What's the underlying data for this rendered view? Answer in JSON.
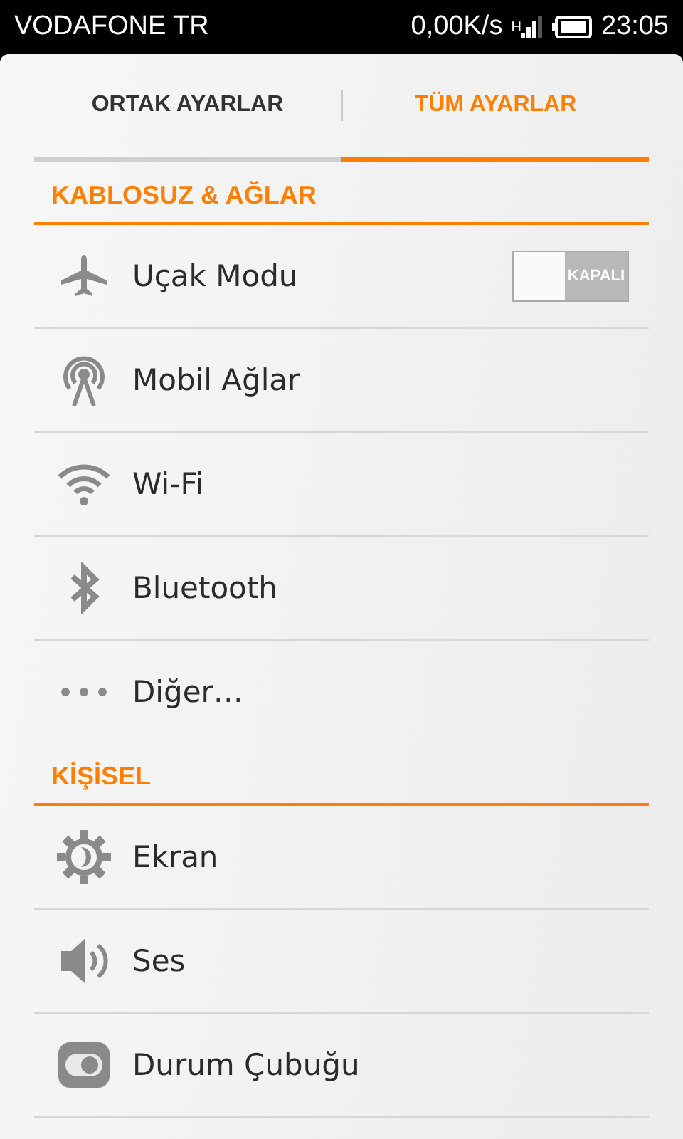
{
  "status_bar": {
    "carrier": "VODAFONE TR",
    "speed": "0,00K/s",
    "network_type": "H",
    "time": "23:05"
  },
  "tabs": [
    {
      "label": "ORTAK AYARLAR",
      "selected": false
    },
    {
      "label": "TÜM AYARLAR",
      "selected": true
    }
  ],
  "sections": [
    {
      "title": "KABLOSUZ & AĞLAR",
      "items": [
        {
          "label": "Uçak Modu",
          "kind": "switch",
          "on": false,
          "switch_label": "KAPALI"
        },
        {
          "label": "Mobil Ağlar",
          "kind": "plain"
        },
        {
          "label": "Wi-Fi",
          "kind": "plain"
        },
        {
          "label": "Bluetooth",
          "kind": "plain"
        },
        {
          "label": "Diğer…",
          "kind": "plain"
        }
      ]
    },
    {
      "title": "KİŞİSEL",
      "items": [
        {
          "label": "Ekran",
          "kind": "plain"
        },
        {
          "label": "Ses",
          "kind": "plain"
        },
        {
          "label": "Durum Çubuğu",
          "kind": "plain"
        }
      ]
    }
  ]
}
